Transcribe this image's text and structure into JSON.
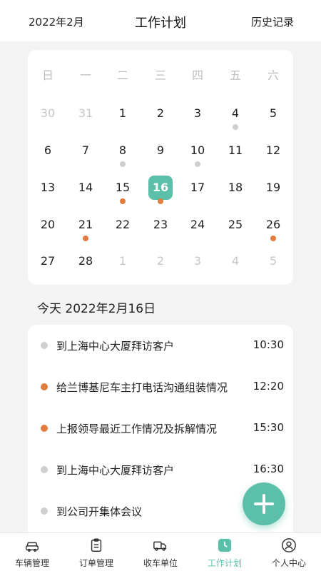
{
  "header": {
    "month": "2022年2月",
    "title": "工作计划",
    "history": "历史记录"
  },
  "calendar": {
    "weekdays": [
      "日",
      "一",
      "二",
      "三",
      "四",
      "五",
      "六"
    ],
    "rows": [
      [
        {
          "d": "30",
          "muted": true
        },
        {
          "d": "31",
          "muted": true
        },
        {
          "d": "1"
        },
        {
          "d": "2"
        },
        {
          "d": "3"
        },
        {
          "d": "4",
          "dot": "gray"
        },
        {
          "d": "5"
        }
      ],
      [
        {
          "d": "6"
        },
        {
          "d": "7"
        },
        {
          "d": "8",
          "dot": "gray"
        },
        {
          "d": "9"
        },
        {
          "d": "10",
          "dot": "gray"
        },
        {
          "d": "11"
        },
        {
          "d": "12"
        }
      ],
      [
        {
          "d": "13"
        },
        {
          "d": "14"
        },
        {
          "d": "15",
          "dot": "orange"
        },
        {
          "d": "16",
          "dot": "orange",
          "selected": true
        },
        {
          "d": "17"
        },
        {
          "d": "18"
        },
        {
          "d": "19"
        }
      ],
      [
        {
          "d": "20"
        },
        {
          "d": "21",
          "dot": "orange"
        },
        {
          "d": "22"
        },
        {
          "d": "23"
        },
        {
          "d": "24"
        },
        {
          "d": "25"
        },
        {
          "d": "26",
          "dot": "orange"
        }
      ],
      [
        {
          "d": "27"
        },
        {
          "d": "28"
        },
        {
          "d": "1",
          "muted": true
        },
        {
          "d": "2",
          "muted": true
        },
        {
          "d": "3",
          "muted": true
        },
        {
          "d": "4",
          "muted": true
        },
        {
          "d": "5",
          "muted": true
        }
      ]
    ]
  },
  "today": {
    "label": "今天 2022年2月16日"
  },
  "tasks": [
    {
      "text": "到上海中心大厦拜访客户",
      "time": "10:30",
      "status": "gray"
    },
    {
      "text": "给兰博基尼车主打电话沟通组装情况",
      "time": "12:20",
      "status": "orange"
    },
    {
      "text": "上报领导最近工作情况及拆解情况",
      "time": "15:30",
      "status": "orange"
    },
    {
      "text": "到上海中心大厦拜访客户",
      "time": "16:30",
      "status": "gray"
    },
    {
      "text": "到公司开集体会议",
      "time": "",
      "status": "gray"
    }
  ],
  "tabs": [
    {
      "label": "车辆管理",
      "icon": "car-icon"
    },
    {
      "label": "订单管理",
      "icon": "clipboard-icon"
    },
    {
      "label": "收车单位",
      "icon": "truck-icon"
    },
    {
      "label": "工作计划",
      "icon": "clock-icon",
      "active": true
    },
    {
      "label": "个人中心",
      "icon": "user-icon"
    }
  ],
  "colors": {
    "accent": "#5bbfa9",
    "dot_gray": "#cfcfcf",
    "dot_orange": "#e07c3e"
  }
}
